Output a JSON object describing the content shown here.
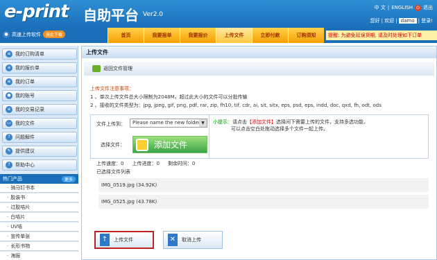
{
  "header": {
    "logo": "e-print",
    "logo_cn": "自助平台",
    "version": "Ver2.0",
    "lang_cn": "中 文",
    "lang_sep": "|",
    "lang_en": "ENGLISH",
    "exit_label": "退出",
    "greeting": "您好",
    "welcome": "| 欢迎 |",
    "username": "damo",
    "login": "| 登录!"
  },
  "nav": {
    "upload_soft": "高速上传软件",
    "download": "按此下载",
    "tabs": [
      "首页",
      "我要报单",
      "我要报价",
      "上传文件",
      "立即付款",
      "订购须知"
    ],
    "active_tab": 3,
    "notice": "提醒: 为避免延误货期, 请及时处理如下订单"
  },
  "sidebar": {
    "items": [
      "我的订购清单",
      "我的报价单",
      "我的订单",
      "我的账号",
      "我的交易记录",
      "我的文件",
      "问题解件",
      "提供建议",
      "帮助中心"
    ],
    "hot_title": "热门产品",
    "more": "更多",
    "products": [
      "骑马钉书本",
      "胶装书",
      "过胶咭片",
      "白咭片",
      "UV咭",
      "宣传单张",
      "长形书物",
      "海报"
    ]
  },
  "main": {
    "title": "上传文件",
    "back_link": "返回文件管理",
    "notes_title": "上传文件注意事项：",
    "note1": "1 、单次上传文件总大小限制为2048M，超过此大小的文件可以分批传输",
    "note2": "2 、接收的文件类型为：jpg, jpeg, gif, png, pdf, rar, zip, fh10, tif, cdr, ai, sit, sitx, eps, psd, eps, indd, doc, qxd, fh, odt, ods",
    "upload_to_label": "文件上传到：",
    "folder_select": "Please name the new folder.",
    "select_file_label": "选择文件：",
    "add_file_btn": "添加文件",
    "tip_key": "小提示：",
    "tip_line1a": "请点击",
    "tip_line1b": "【添加文件】",
    "tip_line1c": "选择间下需要上传的文件，支持多选功能，",
    "tip_line2": "可以点击空白处拖动选择多个文件一起上传。",
    "speed_label": "上传速度：0",
    "progress_label": "上传进度：0",
    "remaining_label": "剩余时间：0",
    "list_label": "已选择文件列表",
    "files": [
      "IMG_0519.jpg (34.92K)",
      "IMG_0525.jpg (43.78K)"
    ],
    "upload_btn": "上传文件",
    "cancel_btn": "取消上传"
  }
}
